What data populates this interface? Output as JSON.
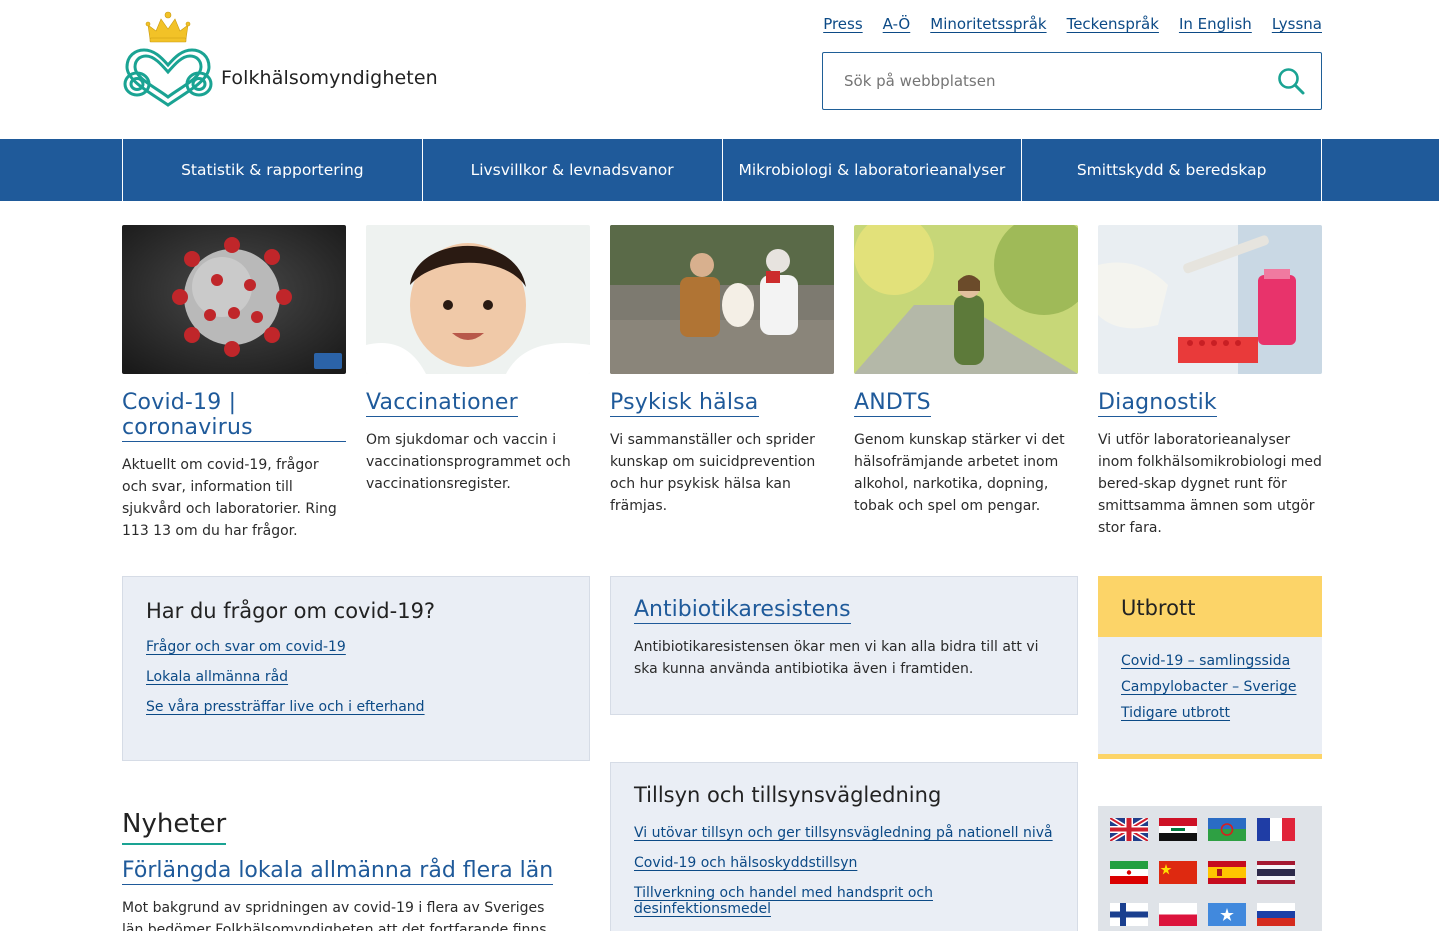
{
  "logo": {
    "name": "Folkhälsomyndigheten",
    "icon": "crown-heart-logo-icon"
  },
  "toplinks": [
    "Press",
    "A-Ö",
    "Minoritetsspråk",
    "Teckenspråk",
    "In English",
    "Lyssna"
  ],
  "search": {
    "placeholder": "Sök på webbplatsen",
    "icon": "search-icon"
  },
  "nav": [
    "Statistik & rapportering",
    "Livsvillkor & levnadsvanor",
    "Mikrobiologi & laboratorieanalyser",
    "Smittskydd & beredskap"
  ],
  "cards": [
    {
      "title": "Covid-19 | coronavirus",
      "text": "Aktuellt om covid-19, frågor och svar, information till sjukvård och laboratorier. Ring 113 13 om du har frågor.",
      "image": "coronavirus-image"
    },
    {
      "title": "Vaccinationer",
      "text": "Om sjukdomar och vaccin i vaccinationsprogrammet och vaccinationsregister.",
      "image": "baby-image"
    },
    {
      "title": "Psykisk hälsa",
      "text": "Vi sammanställer och sprider kunskap om suicidprevention och hur psykisk hälsa kan främjas.",
      "image": "couple-with-dog-image"
    },
    {
      "title": "ANDTS",
      "text": "Genom kunskap stärker vi det hälsofrämjande arbetet inom alkohol, narkotika, dopning, tobak och spel om pengar.",
      "image": "woman-park-image"
    },
    {
      "title": "Diagnostik",
      "text": "Vi utför laboratorieanalyser inom folkhälsomikrobiologi med bered-skap dygnet runt för smittsamma ämnen som utgör stor fara.",
      "image": "laboratory-image"
    }
  ],
  "faq": {
    "title": "Har du frågor om covid-19?",
    "links": [
      "Frågor och svar om covid-19",
      "Lokala allmänna råd",
      "Se våra pressträffar live och i efterhand"
    ]
  },
  "antibiotika": {
    "title": "Antibiotikaresistens",
    "text": "Antibiotikaresistensen ökar men vi kan alla bidra till att vi ska kunna använda antibiotika även i framtiden."
  },
  "tillsyn": {
    "title": "Tillsyn och tillsynsvägledning",
    "links": [
      "Vi utövar tillsyn och ger tillsynsvägledning på nationell nivå",
      "Covid-19 och hälsoskyddstillsyn",
      "Tillverkning och handel med handsprit och desinfektionsmedel"
    ]
  },
  "utbrott": {
    "title": "Utbrott",
    "links": [
      "Covid-19 – samlingssida",
      "Campylobacter – Sverige",
      "Tidigare utbrott"
    ]
  },
  "news": {
    "heading": "Nyheter",
    "title": "Förlängda lokala allmänna råd flera län",
    "text": "Mot bakgrund av spridningen av covid-19 i flera av Sveriges län bedömer Folkhälsomyndigheten att det fortfarande finns behov av"
  },
  "flags": [
    "uk-flag-icon",
    "iraq-flag-icon",
    "romani-flag-icon",
    "france-flag-icon",
    "iran-flag-icon",
    "china-flag-icon",
    "spain-flag-icon",
    "thailand-flag-icon",
    "finland-flag-icon",
    "poland-flag-icon",
    "somalia-flag-icon",
    "russia-flag-icon"
  ],
  "colors": {
    "nav": "#1f5a9a",
    "link": "#0c4a86",
    "accent": "#1aa393",
    "box": "#eaeef5",
    "utbrott": "#fcd468",
    "crown": "#f2c227"
  }
}
